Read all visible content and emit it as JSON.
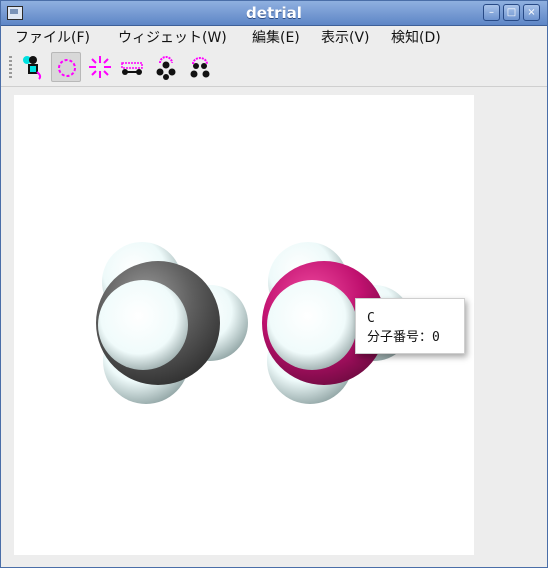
{
  "window": {
    "title": "detrial"
  },
  "titlebar_buttons": [
    "minimize-icon",
    "maximize-icon",
    "close-icon"
  ],
  "menu": [
    {
      "label": "ファイル(F)"
    },
    {
      "label": "ウィジェット(W)"
    },
    {
      "label": "編集(E)"
    },
    {
      "label": "表示(V)"
    },
    {
      "label": "検知(D)"
    }
  ],
  "toolbar": {
    "tools": [
      {
        "icon": "select-molecule-icon"
      },
      {
        "icon": "ring-select-icon",
        "active": true
      },
      {
        "icon": "burst-icon"
      },
      {
        "icon": "bond-bar-icon"
      },
      {
        "icon": "atom-cluster-icon"
      },
      {
        "icon": "atom-cluster-2-icon"
      }
    ]
  },
  "colors": {
    "hydrogen": "#f2fbfb",
    "carbon": "#5a5a5a",
    "highlight": "#c0116f",
    "accent_magenta": "#ff00ff",
    "accent_cyan": "#00e0e0"
  },
  "tooltip": {
    "element": "C",
    "index_label": "分子番号：0"
  }
}
